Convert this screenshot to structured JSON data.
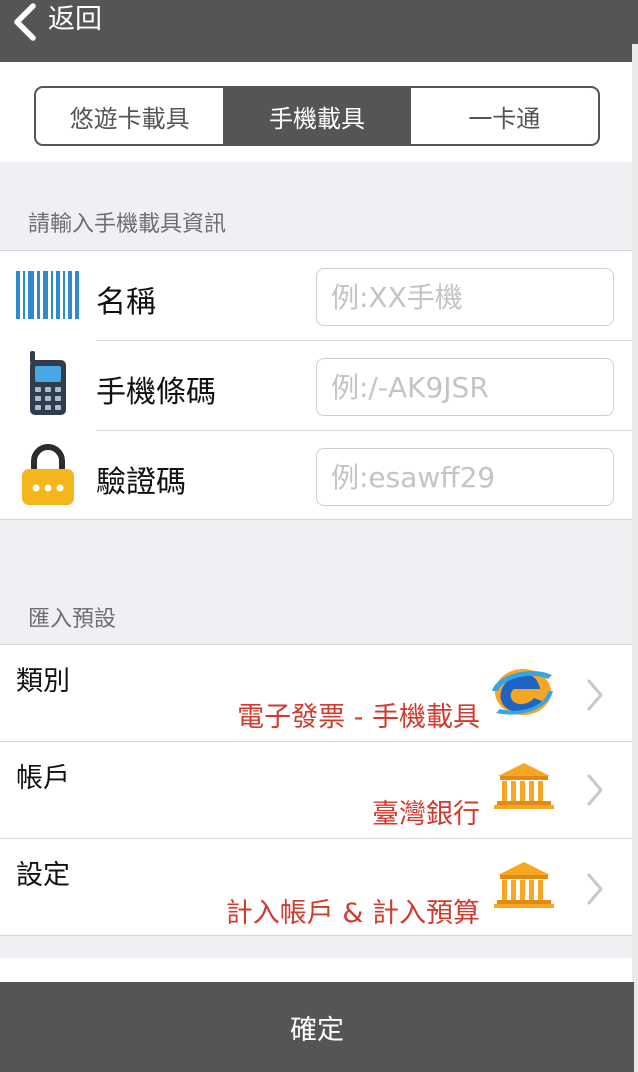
{
  "header": {
    "back_label": "返回"
  },
  "tabs": [
    {
      "label": "悠遊卡載具",
      "active": false
    },
    {
      "label": "手機載具",
      "active": true
    },
    {
      "label": "一卡通",
      "active": false
    }
  ],
  "carrier_section": {
    "title": "請輸入手機載具資訊",
    "fields": [
      {
        "label": "名稱",
        "placeholder": "例:XX手機",
        "icon": "barcode-icon"
      },
      {
        "label": "手機條碼",
        "placeholder": "例:/-AK9JSR",
        "icon": "mobile-phone-icon"
      },
      {
        "label": "驗證碼",
        "placeholder": "例:esawff29",
        "icon": "lock-icon"
      }
    ]
  },
  "import_section": {
    "title": "匯入預設",
    "rows": [
      {
        "title": "類別",
        "value": "電子發票 - 手機載具",
        "icon": "e-invoice-logo-icon"
      },
      {
        "title": "帳戶",
        "value": "臺灣銀行",
        "icon": "bank-icon"
      },
      {
        "title": "設定",
        "value": "計入帳戶 & 計入預算",
        "icon": "bank-icon"
      }
    ]
  },
  "confirm_label": "確定",
  "colors": {
    "bar": "#555555",
    "accent_text": "#d13b2f",
    "section_bg": "#efeff4",
    "icon_blue": "#2e8bc9",
    "icon_gold": "#f5b61c"
  }
}
